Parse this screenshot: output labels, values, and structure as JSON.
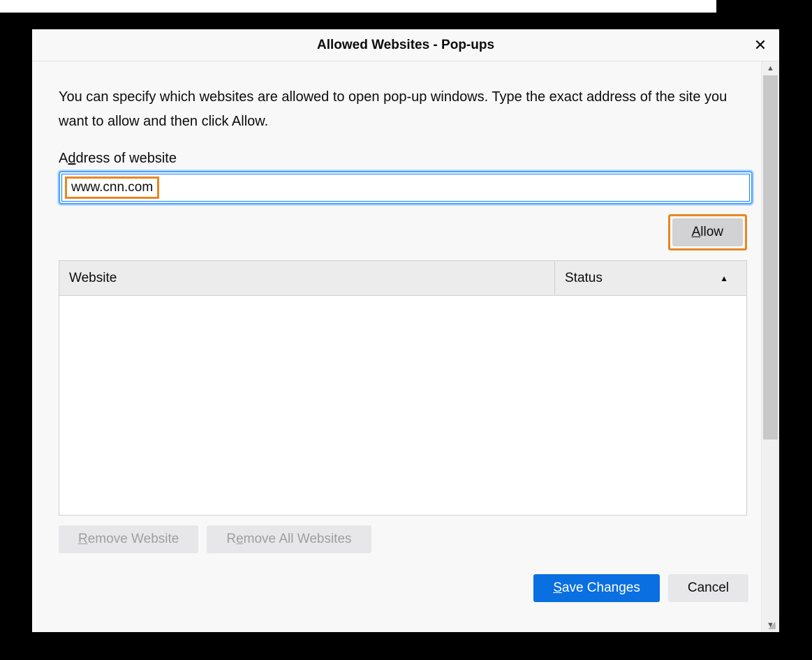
{
  "dialog": {
    "title": "Allowed Websites - Pop-ups",
    "close_icon": "✕",
    "description": "You can specify which websites are allowed to open pop-up windows. Type the exact address of the site you want to allow and then click Allow.",
    "address_label_pre": "A",
    "address_label_ul": "d",
    "address_label_post": "dress of website",
    "address_value": "www.cnn.com",
    "allow_btn_ul": "A",
    "allow_btn_post": "llow",
    "table": {
      "col_website": "Website",
      "col_status": "Status",
      "sort_icon": "▲"
    },
    "remove_btn_ul": "R",
    "remove_btn_post": "emove Website",
    "remove_all_pre": "R",
    "remove_all_ul": "e",
    "remove_all_post": "move All Websites",
    "save_btn_ul": "S",
    "save_btn_post": "ave Changes",
    "cancel_btn": "Cancel"
  }
}
